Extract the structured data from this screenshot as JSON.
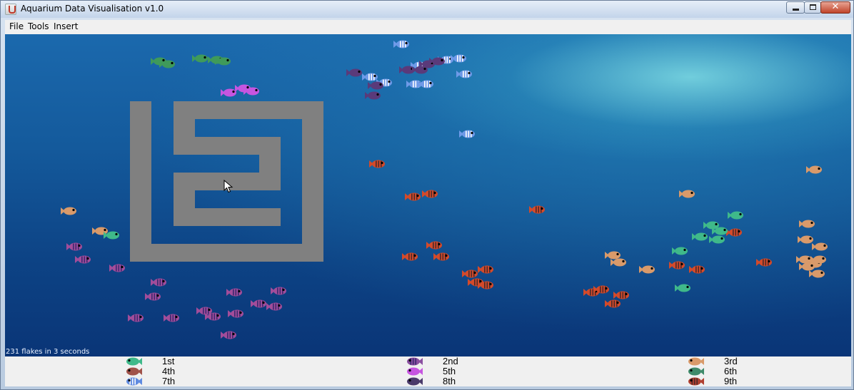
{
  "window": {
    "title": "Aquarium Data Visualisation v1.0",
    "close_glyph": "✕"
  },
  "menu": {
    "items": [
      "File",
      "Tools",
      "Insert"
    ]
  },
  "aquarium": {
    "status_text": "231 flakes in 3 seconds",
    "background_colors": [
      "#1b69ad",
      "#0a3577"
    ],
    "maze_color": "#808080"
  },
  "fish_colors": {
    "green": {
      "body": "#3fb98a",
      "stripe": null
    },
    "tan": {
      "body": "#d99a6a",
      "stripe": null
    },
    "red_striped": {
      "body": "#d44a2a",
      "stripe": "#4a2a2a"
    },
    "purple_striped": {
      "body": "#a24d9a",
      "stripe": "#3b2870"
    },
    "blue_striped": {
      "body": "#6f9ae8",
      "stripe": "#ffffff"
    },
    "magenta": {
      "body": "#c655e0",
      "stripe": null
    },
    "dark_purple": {
      "body": "#5a3a7a",
      "stripe": null
    },
    "forest_green": {
      "body": "#3f9a5a",
      "stripe": null
    }
  },
  "legend": [
    {
      "rank": "1st",
      "icon": "green-fish-icon",
      "color": "#3fb98a",
      "stripe": null
    },
    {
      "rank": "2nd",
      "icon": "purple-striped-fish-icon",
      "color": "#8a4fa0",
      "stripe": "#3b2870"
    },
    {
      "rank": "3rd",
      "icon": "tan-fish-icon",
      "color": "#d99a6a",
      "stripe": null
    },
    {
      "rank": "4th",
      "icon": "brown-fish-icon",
      "color": "#a0524a",
      "stripe": null
    },
    {
      "rank": "5th",
      "icon": "magenta-fish-icon",
      "color": "#c655e0",
      "stripe": null
    },
    {
      "rank": "6th",
      "icon": "dark-green-fish-icon",
      "color": "#3f8a6a",
      "stripe": null
    },
    {
      "rank": "7th",
      "icon": "blue-striped-fish-icon",
      "color": "#5f8ae0",
      "stripe": "#ffffff"
    },
    {
      "rank": "8th",
      "icon": "dark-purple-fish-icon",
      "color": "#4a3a6a",
      "stripe": null
    },
    {
      "rank": "9th",
      "icon": "red-striped-fish-icon",
      "color": "#b04030",
      "stripe": "#4a2a2a"
    }
  ]
}
